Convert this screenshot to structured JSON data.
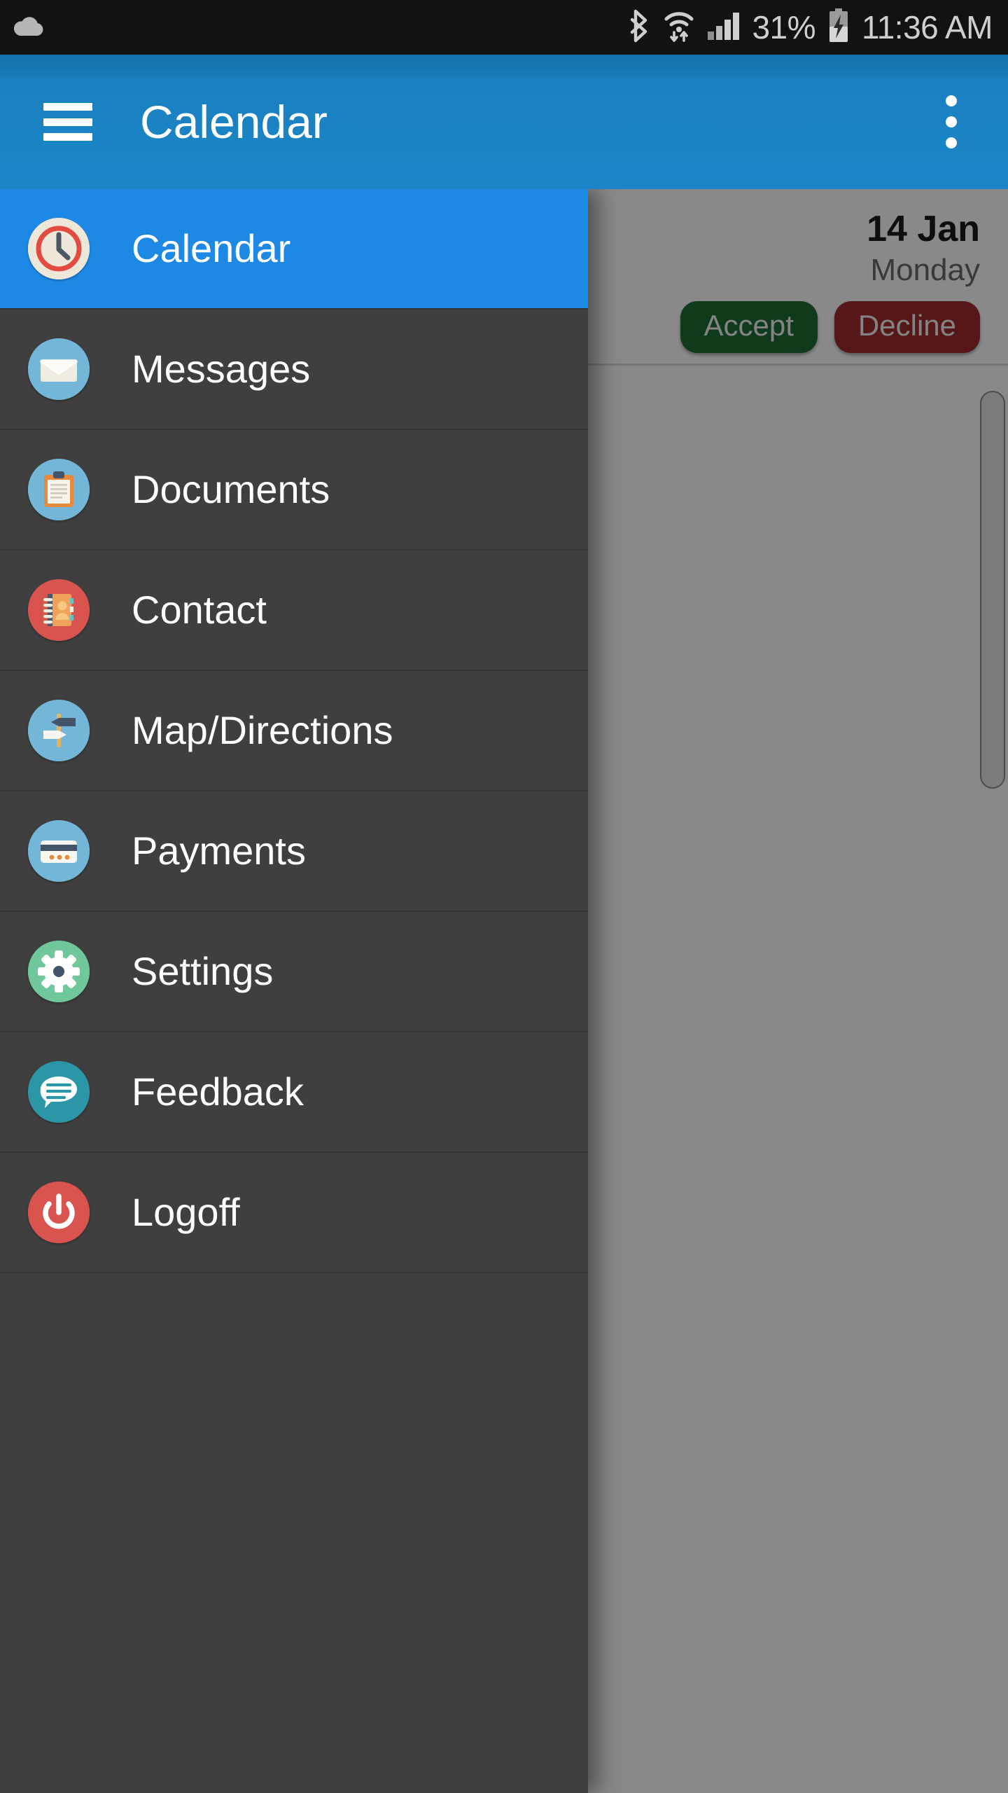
{
  "status_bar": {
    "left_icons": [
      {
        "name": "cloud-icon",
        "glyph": "cloud"
      }
    ],
    "right_icons": [
      {
        "name": "bluetooth-icon",
        "glyph": "bluetooth"
      },
      {
        "name": "wifi-icon",
        "glyph": "wifi-transfer"
      },
      {
        "name": "cellular-signal-icon",
        "glyph": "signal-bars"
      }
    ],
    "battery_percent": "31%",
    "battery_icon_name": "battery-charging-icon",
    "clock": "11:36 AM",
    "background": "#121212",
    "foreground": "#cfcfcf"
  },
  "app_bar": {
    "menu_icon_name": "hamburger-menu-icon",
    "title": "Calendar",
    "overflow_icon_name": "overflow-menu-icon",
    "background": "#1b85c7",
    "text_color": "#ffffff"
  },
  "drawer": {
    "background": "#3f3f3f",
    "active_background": "#1e88e5",
    "label_color": "#ffffff",
    "items": [
      {
        "label": "Calendar",
        "icon": "clock-icon",
        "icon_bg": "#ede7d9",
        "active": true
      },
      {
        "label": "Messages",
        "icon": "envelope-icon",
        "icon_bg": "#73b6d8",
        "active": false
      },
      {
        "label": "Documents",
        "icon": "clipboard-icon",
        "icon_bg": "#73b6d8",
        "active": false
      },
      {
        "label": "Contact",
        "icon": "address-book-icon",
        "icon_bg": "#d9534f",
        "active": false
      },
      {
        "label": "Map/Directions",
        "icon": "signpost-icon",
        "icon_bg": "#73b6d8",
        "active": false
      },
      {
        "label": "Payments",
        "icon": "credit-card-icon",
        "icon_bg": "#73b6d8",
        "active": false
      },
      {
        "label": "Settings",
        "icon": "gear-icon",
        "icon_bg": "#6fc79b",
        "active": false
      },
      {
        "label": "Feedback",
        "icon": "speech-bubble-icon",
        "icon_bg": "#2b96a5",
        "active": false
      },
      {
        "label": "Logoff",
        "icon": "power-icon",
        "icon_bg": "#d9534f",
        "active": false
      }
    ]
  },
  "content": {
    "event": {
      "date": "14 Jan",
      "day": "Monday",
      "accept_label": "Accept",
      "decline_label": "Decline",
      "accept_color": "#1d6b33",
      "decline_color": "#9e2b2b"
    },
    "scrollbar_visible": true
  }
}
